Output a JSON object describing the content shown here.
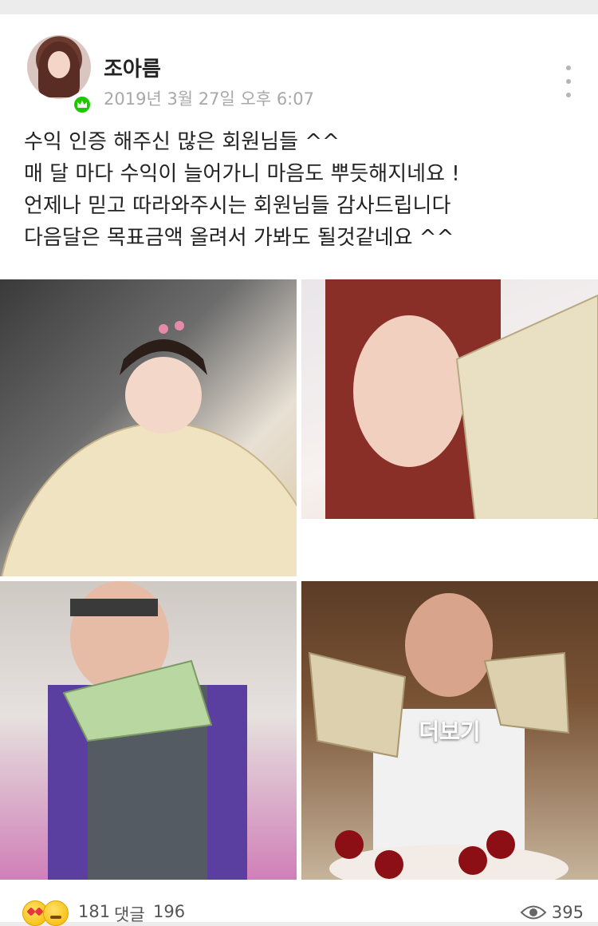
{
  "post": {
    "author": "조아름",
    "timestamp": "2019년 3월 27일 오후 6:07",
    "body_lines": [
      "수익 인증 해주신 많은 회원님들 ^^",
      "매 달 마다 수익이 늘어가니 마음도 뿌듯해지네요 !",
      "언제나 믿고 따라와주시는 회원님들 감사드립니다",
      "다음달은 목표금액 올려서 가봐도 될것같네요 ^^"
    ],
    "photos": [
      {
        "icon": "photo-baby-with-money"
      },
      {
        "icon": "photo-woman-with-money"
      },
      {
        "icon": "photo-man-with-money"
      },
      {
        "icon": "photo-man-with-cake-money"
      }
    ],
    "more_label": "더보기"
  },
  "footer": {
    "reaction_icons": [
      "love-eyes-emoji",
      "thumbs-up-emoji"
    ],
    "likes": "181",
    "comments_label": "댓글",
    "comments_count": "196",
    "views": "395"
  },
  "colors": {
    "badge_green": "#1ec800",
    "muted_text": "#a8a8a8",
    "background": "#ececec"
  }
}
